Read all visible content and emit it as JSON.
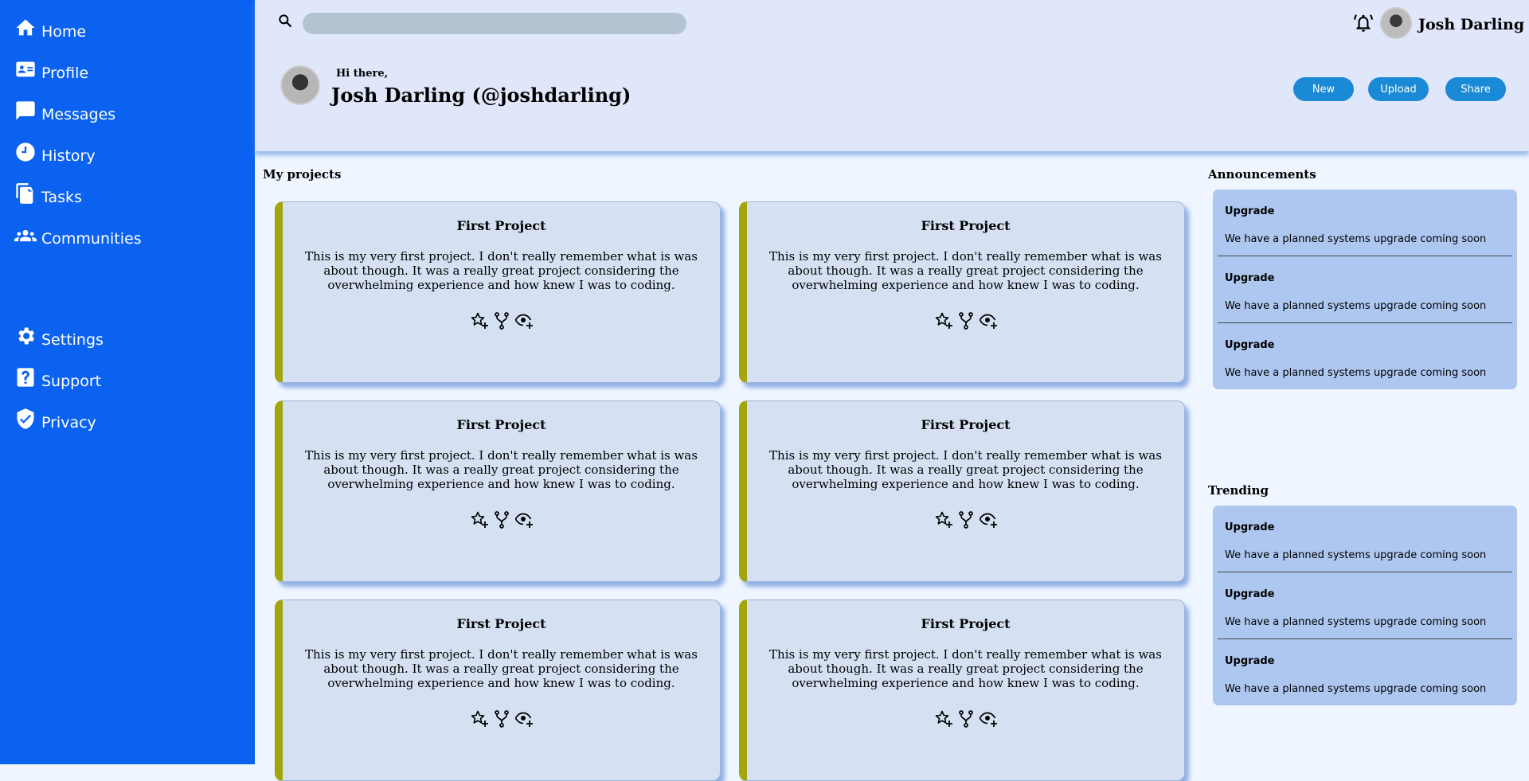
{
  "sidebar": {
    "items": [
      {
        "label": "Home",
        "icon": "home-icon"
      },
      {
        "label": "Profile",
        "icon": "id-card-icon"
      },
      {
        "label": "Messages",
        "icon": "message-icon"
      },
      {
        "label": "History",
        "icon": "clock-icon"
      },
      {
        "label": "Tasks",
        "icon": "document-icon"
      },
      {
        "label": "Communities",
        "icon": "people-icon"
      },
      {
        "label": "Settings",
        "icon": "gear-icon"
      },
      {
        "label": "Support",
        "icon": "help-icon"
      },
      {
        "label": "Privacy",
        "icon": "shield-icon"
      }
    ]
  },
  "topbar": {
    "search_placeholder": "",
    "username": "Josh Darling"
  },
  "hero": {
    "greeting": "Hi there,",
    "display_name": "Josh Darling (@joshdarling)",
    "buttons": {
      "new": "New",
      "upload": "Upload",
      "share": "Share"
    }
  },
  "projects": {
    "title": "My projects",
    "cards": [
      {
        "title": "First Project",
        "description": "This is my very first project. I don't really remember what is was about though. It was a really great project considering the overwhelming experience and how knew I was to coding."
      },
      {
        "title": "First Project",
        "description": "This is my very first project. I don't really remember what is was about though. It was a really great project considering the overwhelming experience and how knew I was to coding."
      },
      {
        "title": "First Project",
        "description": "This is my very first project. I don't really remember what is was about though. It was a really great project considering the overwhelming experience and how knew I was to coding."
      },
      {
        "title": "First Project",
        "description": "This is my very first project. I don't really remember what is was about though. It was a really great project considering the overwhelming experience and how knew I was to coding."
      },
      {
        "title": "First Project",
        "description": "This is my very first project. I don't really remember what is was about though. It was a really great project considering the overwhelming experience and how knew I was to coding."
      },
      {
        "title": "First Project",
        "description": "This is my very first project. I don't really remember what is was about though. It was a really great project considering the overwhelming experience and how knew I was to coding."
      }
    ],
    "action_icons": [
      "star-add-icon",
      "fork-icon",
      "watch-add-icon"
    ]
  },
  "announcements": {
    "title": "Announcements",
    "items": [
      {
        "title": "Upgrade",
        "text": "We have a planned systems upgrade coming soon"
      },
      {
        "title": "Upgrade",
        "text": "We have a planned systems upgrade coming soon"
      },
      {
        "title": "Upgrade",
        "text": "We have a planned systems upgrade coming soon"
      }
    ]
  },
  "trending": {
    "title": "Trending",
    "items": [
      {
        "title": "Upgrade",
        "text": "We have a planned systems upgrade coming soon"
      },
      {
        "title": "Upgrade",
        "text": "We have a planned systems upgrade coming soon"
      },
      {
        "title": "Upgrade",
        "text": "We have a planned systems upgrade coming soon"
      }
    ]
  },
  "colors": {
    "sidebar": "#0b62f0",
    "header": "#e0e7fb",
    "accent_button": "#1a8ad6",
    "card": "#d5e1f3",
    "card_stripe": "#a4a40d",
    "panel": "#adc7f0"
  }
}
